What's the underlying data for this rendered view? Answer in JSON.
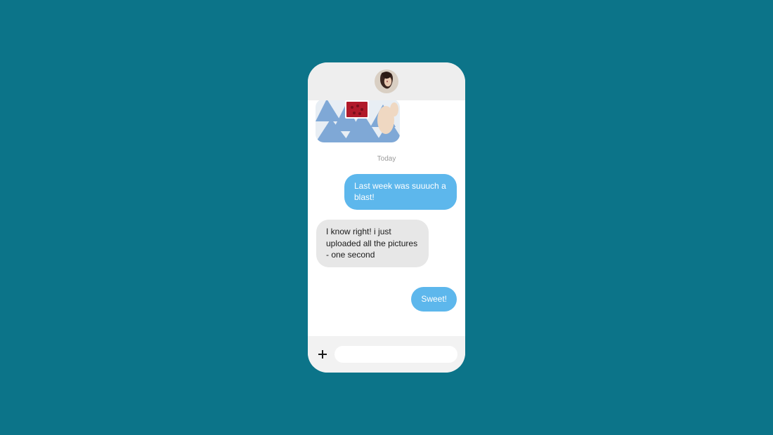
{
  "header": {
    "avatar_name": "contact-avatar"
  },
  "thread": {
    "image_message_name": "image-message",
    "separator": "Today",
    "messages": [
      {
        "side": "sent",
        "text": "Last week was suuuch a blast!"
      },
      {
        "side": "received",
        "text": "I know right! i just uploaded all the pictures - one second"
      },
      {
        "side": "sent",
        "text": "Sweet!"
      }
    ]
  },
  "composer": {
    "placeholder": "",
    "value": ""
  },
  "colors": {
    "sent_bubble": "#5db7ec",
    "received_bubble": "#e7e7e7",
    "background": "#0c7489"
  }
}
